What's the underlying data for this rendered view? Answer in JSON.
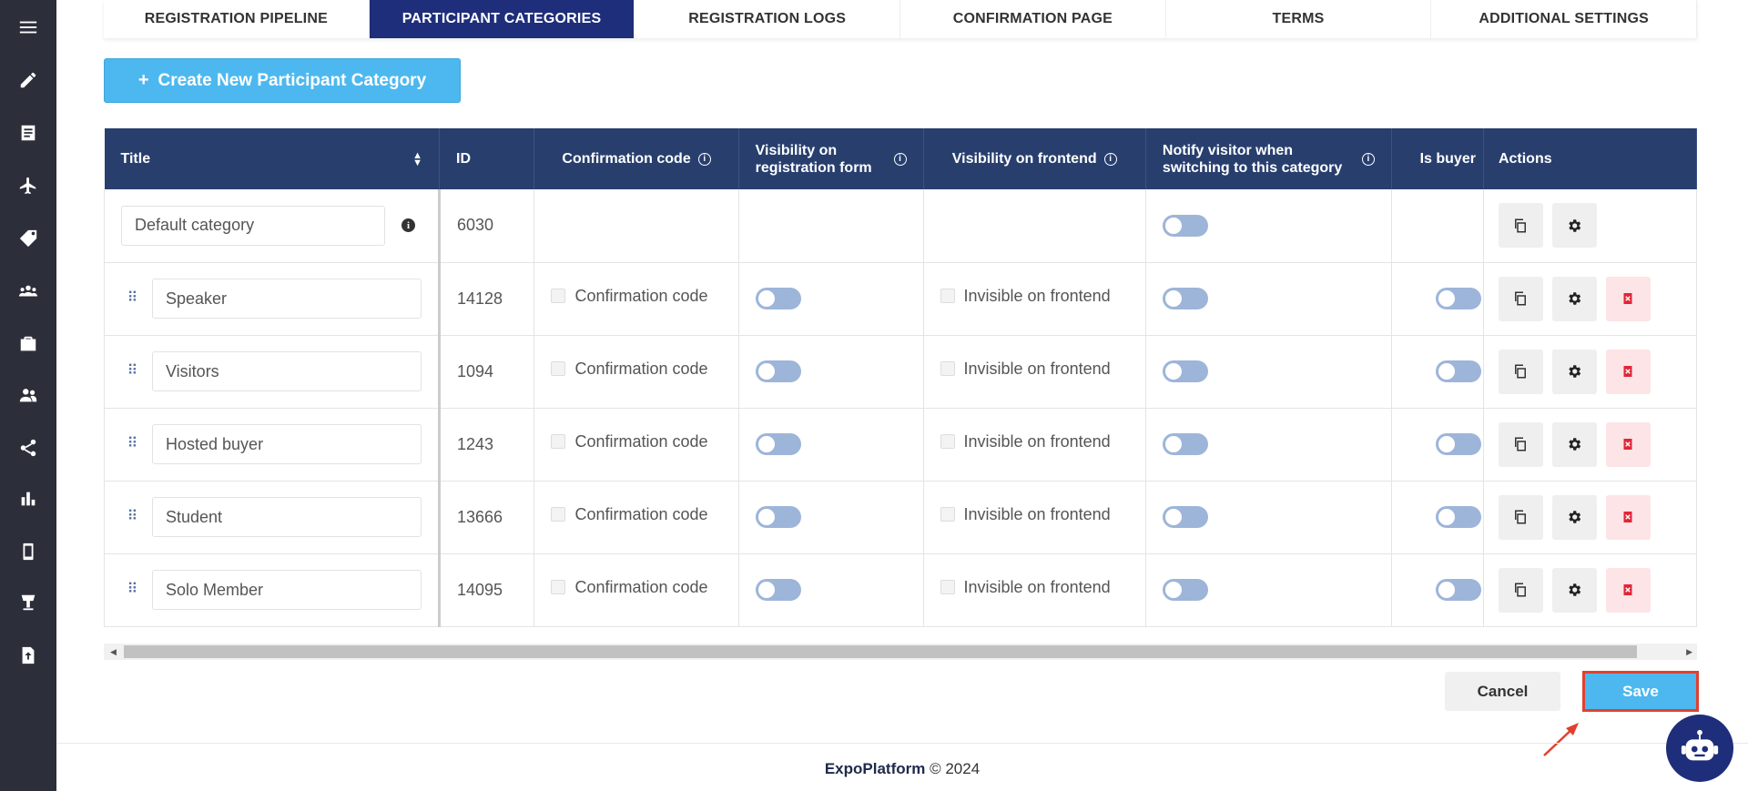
{
  "sidebar": {
    "icons": [
      "menu-icon",
      "pencil-icon",
      "document-icon",
      "plane-icon",
      "tag-icon",
      "group-icon",
      "briefcase-icon",
      "users-icon",
      "share-icon",
      "bar-chart-icon",
      "mobile-icon",
      "stand-icon",
      "upload-icon"
    ]
  },
  "tabs": [
    {
      "label": "REGISTRATION PIPELINE",
      "active": false
    },
    {
      "label": "PARTICIPANT CATEGORIES",
      "active": true
    },
    {
      "label": "REGISTRATION LOGS",
      "active": false
    },
    {
      "label": "CONFIRMATION PAGE",
      "active": false
    },
    {
      "label": "TERMS",
      "active": false
    },
    {
      "label": "ADDITIONAL SETTINGS",
      "active": false
    }
  ],
  "create_button": {
    "icon": "+",
    "label": "Create New Participant Category"
  },
  "table": {
    "headers": {
      "title": "Title",
      "id": "ID",
      "confirmation_code": "Confirmation code",
      "visibility_registration": "Visibility on registration form",
      "visibility_frontend": "Visibility on frontend",
      "notify_visitor": "Notify visitor when switching to this category",
      "is_buyer": "Is buyer",
      "actions": "Actions"
    },
    "default_row": {
      "title": "Default category",
      "id": "6030"
    },
    "confirmation_label": "Confirmation code",
    "invisible_label": "Invisible on frontend",
    "rows": [
      {
        "title": "Speaker",
        "id": "14128"
      },
      {
        "title": "Visitors",
        "id": "1094"
      },
      {
        "title": "Hosted buyer",
        "id": "1243"
      },
      {
        "title": "Student",
        "id": "13666"
      },
      {
        "title": "Solo Member",
        "id": "14095"
      }
    ]
  },
  "buttons": {
    "cancel": "Cancel",
    "save": "Save"
  },
  "footer": {
    "brand": "ExpoPlatform",
    "copyright": "© 2024"
  },
  "colors": {
    "accent": "#4db8ef",
    "header": "#283f6e",
    "active_tab": "#1f2e7a",
    "sidebar": "#2c2f3a",
    "highlight": "#e0402f"
  }
}
